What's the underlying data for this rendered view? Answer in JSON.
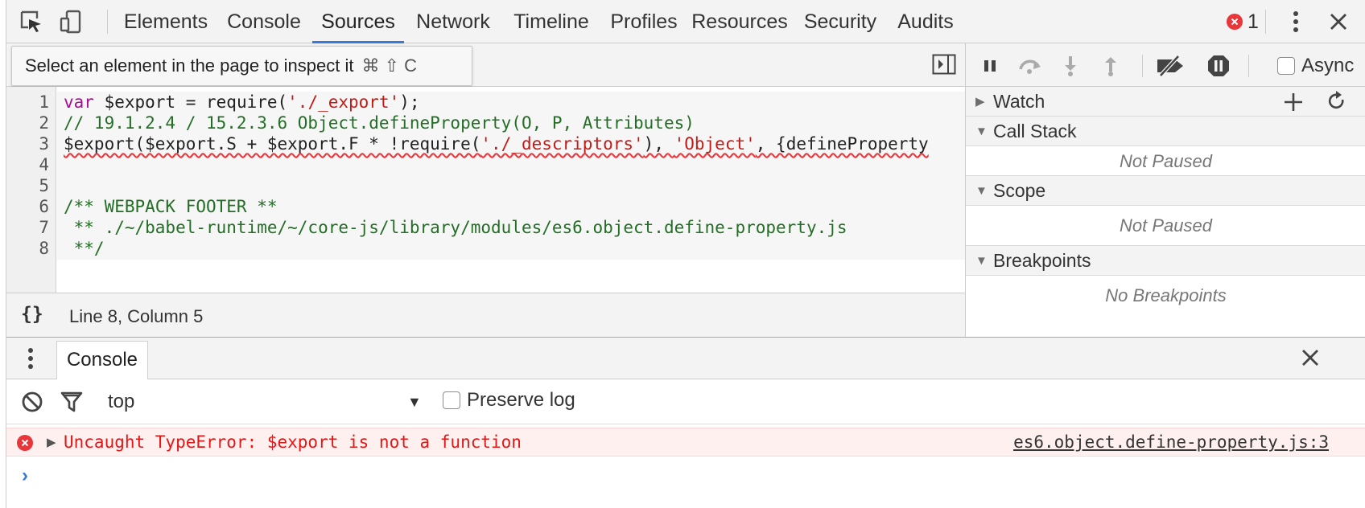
{
  "toolbar": {
    "tabs": [
      {
        "label": "Elements"
      },
      {
        "label": "Console"
      },
      {
        "label": "Sources"
      },
      {
        "label": "Network"
      },
      {
        "label": "Timeline"
      },
      {
        "label": "Profiles"
      },
      {
        "label": "Resources"
      },
      {
        "label": "Security"
      },
      {
        "label": "Audits"
      }
    ],
    "active_tab": "Sources",
    "error_count": "1"
  },
  "sources": {
    "inspect_tooltip": "Select an element in the page to inspect it",
    "inspect_shortcut": "⌘ ⇧ C",
    "line_numbers": [
      "1",
      "2",
      "3",
      "4",
      "5",
      "6",
      "7",
      "8"
    ],
    "code": {
      "l1_kw": "var",
      "l1_a": " $export = require(",
      "l1_str": "'./_export'",
      "l1_b": ");",
      "l2": "// 19.1.2.4 / 15.2.3.6 Object.defineProperty(O, P, Attributes)",
      "l3_a": "$export($export.S + $export.F * !require(",
      "l3_str1": "'./_descriptors'",
      "l3_b": "), ",
      "l3_str2": "'Object'",
      "l3_c": ", {defineProperty",
      "l6": "/** WEBPACK FOOTER **",
      "l7": " ** ./~/babel-runtime/~/core-js/library/modules/es6.object.define-property.js",
      "l8": " **/"
    },
    "status_braces": "{}",
    "cursor_position": "Line 8, Column 5"
  },
  "debugger": {
    "async_label": "Async",
    "panes": {
      "watch": {
        "title": "Watch"
      },
      "call_stack": {
        "title": "Call Stack",
        "body": "Not Paused"
      },
      "scope": {
        "title": "Scope",
        "body": "Not Paused"
      },
      "breakpoints": {
        "title": "Breakpoints",
        "body": "No Breakpoints"
      }
    }
  },
  "drawer": {
    "tab_label": "Console",
    "context": "top",
    "preserve_log_label": "Preserve log",
    "error": {
      "message": "Uncaught TypeError: $export is not a function",
      "source_link": "es6.object.define-property.js:3"
    },
    "prompt": "›"
  },
  "colors": {
    "accent": "#3879d9",
    "error": "#e8363a",
    "keyword": "#aa0d91",
    "string": "#c41a16",
    "comment": "#236e25"
  }
}
